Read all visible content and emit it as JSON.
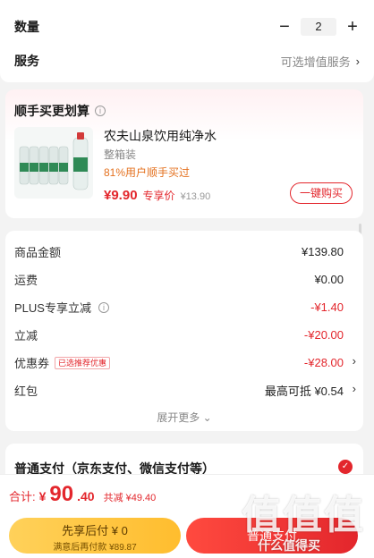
{
  "order": {
    "quantity_label": "数量",
    "quantity_value": "2",
    "minus": "−",
    "plus": "+",
    "service_label": "服务",
    "service_value": "可选增值服务",
    "chevron": "›"
  },
  "bundle": {
    "title": "顺手买更划算",
    "info": "i",
    "product_name": "农夫山泉饮用纯净水",
    "spec": "整箱装",
    "note": "81%用户顺手买过",
    "price_now": "¥9.90",
    "price_tag": "专享价",
    "price_old": "¥13.90",
    "buy_label": "一键购买"
  },
  "summary": {
    "rows": [
      {
        "label": "商品金额",
        "value": "¥139.80"
      },
      {
        "label": "运费",
        "value": "¥0.00"
      },
      {
        "label": "PLUS专享立减",
        "value": "-¥1.40"
      },
      {
        "label": "立减",
        "value": "-¥20.00"
      },
      {
        "label": "优惠券",
        "badge": "已选推荐优惠",
        "value": "-¥28.00"
      },
      {
        "label": "红包",
        "value": "最高可抵 ¥0.54"
      }
    ],
    "expand_label": "展开更多 ⌄"
  },
  "payment": {
    "title": "普通支付（京东支付、微信支付等）",
    "check": "✓"
  },
  "bottom": {
    "total_label": "合计:",
    "total_symbol": "¥",
    "total_int": "90",
    "total_dec": ".40",
    "total_save": "共减 ¥49.40",
    "later_line1": "先享后付 ¥ 0",
    "later_line2": "满意后再付款 ¥89.87",
    "pay_label": "普通支付"
  },
  "watermark": {
    "big": "值值值",
    "small": "什么值得买"
  },
  "colors": {
    "accent": "#e3262c",
    "orange": "#e4711f",
    "yellow": "#ffc53d"
  }
}
